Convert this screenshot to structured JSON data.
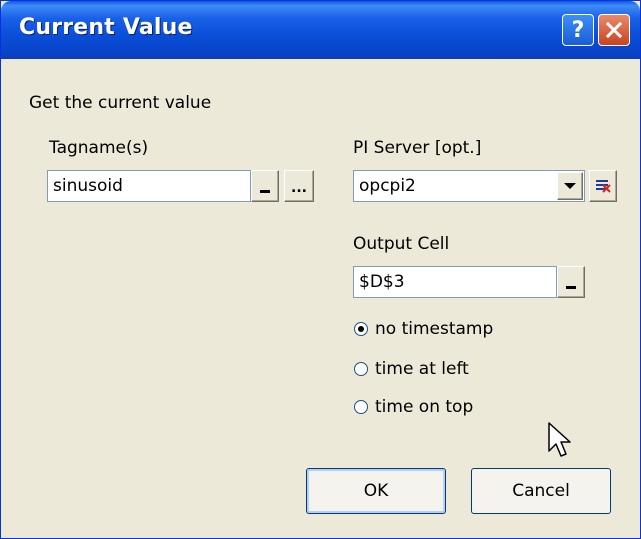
{
  "window": {
    "title": "Current Value"
  },
  "description": "Get the current value",
  "tagnames": {
    "label": "Tagname(s)",
    "value": "sinusoid"
  },
  "pi_server": {
    "label": "PI Server [opt.]",
    "value": "opcpi2"
  },
  "output_cell": {
    "label": "Output Cell",
    "value": "$D$3"
  },
  "timestamp_options": [
    {
      "label": "no timestamp",
      "checked": true
    },
    {
      "label": "time at left",
      "checked": false
    },
    {
      "label": "time on top",
      "checked": false
    }
  ],
  "buttons": {
    "ok": "OK",
    "cancel": "Cancel",
    "help": "?"
  }
}
